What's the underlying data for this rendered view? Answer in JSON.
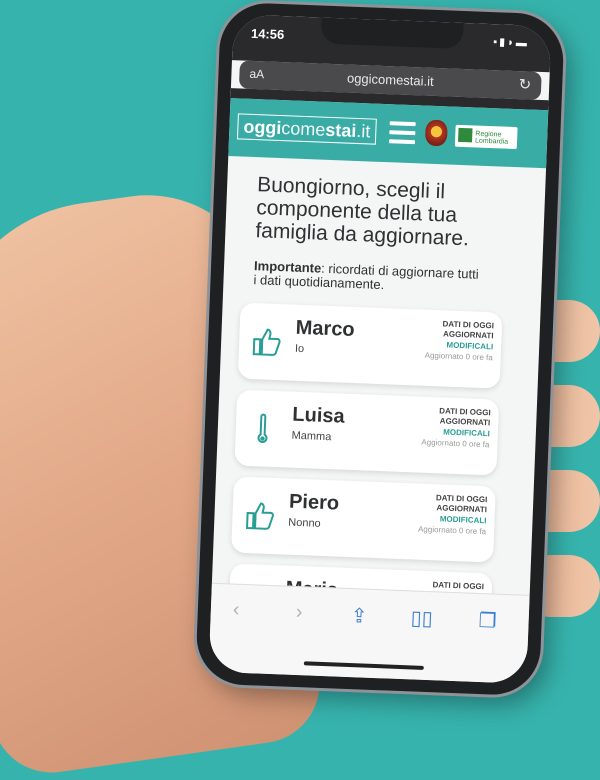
{
  "statusbar": {
    "time": "14:56",
    "icons": "▪▮◗▬"
  },
  "browser": {
    "text_size_label": "aA",
    "url": "oggicomestai.it",
    "reload_icon": "reload-icon"
  },
  "app": {
    "logo_part1": "oggi",
    "logo_part2": "come",
    "logo_part3": "stai",
    "logo_part4": ".it",
    "region_logo_text": "Regione Lombardia"
  },
  "greeting": "Buongiorno, scegli il componente della tua famiglia da aggiornare.",
  "note": {
    "label": "Importante",
    "text": ": ricordati di aggiornare tutti i dati quotidianamente."
  },
  "members": [
    {
      "name": "Marco",
      "role": "Io",
      "icon": "thumbs-up-icon",
      "updated": "DATI DI OGGI AGGIORNATI",
      "action": "MODIFICALI",
      "ago": "Aggiornato 0 ore fa"
    },
    {
      "name": "Luisa",
      "role": "Mamma",
      "icon": "thermometer-icon",
      "updated": "DATI DI OGGI AGGIORNATI",
      "action": "MODIFICALI",
      "ago": "Aggiornato 0 ore fa"
    },
    {
      "name": "Piero",
      "role": "Nonno",
      "icon": "thumbs-up-icon",
      "updated": "DATI DI OGGI AGGIORNATI",
      "action": "MODIFICALI",
      "ago": "Aggiornato 0 ore fa"
    },
    {
      "name": "Maria",
      "role": "",
      "icon": "",
      "updated": "DATI DI OGGI AGGIORNATI",
      "action": "",
      "ago": ""
    }
  ],
  "toolbar": {
    "back": "‹",
    "forward": "›",
    "share": "⇪",
    "bookmarks": "▯▯",
    "tabs": "❐"
  },
  "colors": {
    "accent": "#3aaca6",
    "background": "#37b3ad",
    "link": "#2a9d96"
  }
}
